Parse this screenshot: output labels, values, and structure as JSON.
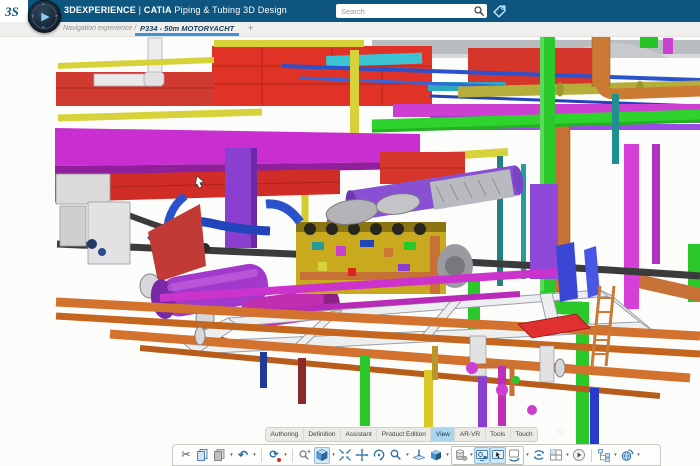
{
  "header": {
    "brand": "3DEXPERIENCE",
    "divider": "|",
    "app": "CATIA",
    "app_suffix": " Piping & Tubing 3D Design",
    "search_placeholder": "Search",
    "logo_glyph": "3S",
    "compass": {
      "play": "▶",
      "n": "▴",
      "s": "▾",
      "e": "▸",
      "w": "◂"
    }
  },
  "nav": {
    "breadcrumb": "Navigation experience / P3",
    "tab_label": "P334 - 50m MOTORYACHT",
    "new_tab": "+"
  },
  "footer": {
    "tabs": [
      {
        "label": "Authoring",
        "active": false
      },
      {
        "label": "Definition",
        "active": false
      },
      {
        "label": "Assistant",
        "active": false
      },
      {
        "label": "Product Edition",
        "active": false
      },
      {
        "label": "View",
        "active": true
      },
      {
        "label": "AR-VR",
        "active": false
      },
      {
        "label": "Tools",
        "active": false
      },
      {
        "label": "Touch",
        "active": false
      }
    ],
    "favorite_glyph": "♡"
  },
  "toolbar": {
    "caret": "▾",
    "glyphs": {
      "cut": "✂",
      "undo": "↶",
      "update": "⟳"
    },
    "icons": [
      "cut",
      "copy",
      "paste",
      "undo",
      "update",
      "search-model",
      "iso-view-cube",
      "fit-all",
      "pan",
      "rotate",
      "zoom",
      "normal-to",
      "shaded-view",
      "section",
      "render-settings",
      "pointer-mode",
      "rotate-screen",
      "turntable",
      "multi-viewport",
      "more-commands",
      "design-tree",
      "world-orientation"
    ]
  },
  "colors": {
    "topbar": "#0e567f",
    "tab_underline": "#3d93d8",
    "active_footer_tab": "#a9d5ef",
    "selected_tool": "#cfe7f7"
  },
  "scene_palette": {
    "red_duct": "#d5352b",
    "magenta_duct": "#c92fd0",
    "purple_duct": "#8a50d4",
    "yellow_pipe": "#d8d23a",
    "green_pipe": "#2ac82a",
    "olive_pipe": "#b5ae3a",
    "orange_pipe": "#d2722e",
    "copper": "#c87137",
    "blue_pipe": "#2a52cc",
    "teal_pipe": "#1f8f8f",
    "steel_frame": "#eceef0",
    "dark_pipe": "#3b3b3d",
    "engine_yellow": "#c9a91e"
  }
}
